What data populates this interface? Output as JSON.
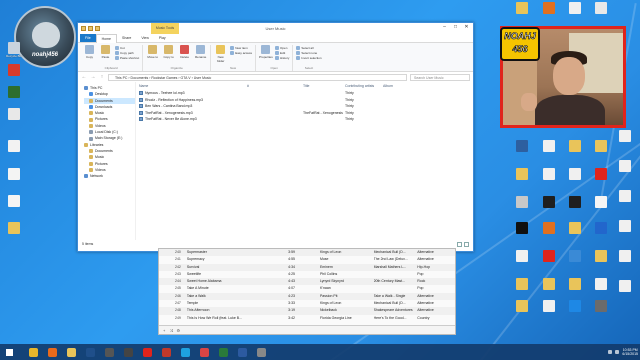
{
  "logo": {
    "text": "noahj456"
  },
  "desktop_left": [
    {
      "label": "Recycle Bin",
      "color": "#c9d3de"
    },
    {
      "label": "",
      "color": "#d83a2a"
    },
    {
      "label": "",
      "color": "#2d6e2e"
    },
    {
      "label": "",
      "color": "#e8e8e8"
    },
    {
      "label": "",
      "color": "#f2f2f2"
    },
    {
      "label": "",
      "color": "#f4f4f4"
    },
    {
      "label": "",
      "color": "#f4f4f4"
    },
    {
      "label": "",
      "color": "#e9c45a"
    }
  ],
  "desktop_right": [
    {
      "label": "",
      "color": "#e9c45a"
    },
    {
      "label": "",
      "color": "#e07020"
    },
    {
      "label": "",
      "color": "#f0f0f0"
    },
    {
      "label": "",
      "color": "#e8e8e8"
    },
    {
      "label": "",
      "color": "#2d5fa0"
    },
    {
      "label": "",
      "color": "#f0f0f0"
    },
    {
      "label": "",
      "color": "#e9c45a"
    },
    {
      "label": "",
      "color": "#e9c45a"
    },
    {
      "label": "",
      "color": "#e9c45a"
    },
    {
      "label": "",
      "color": "#f0f0f0"
    },
    {
      "label": "",
      "color": "#f0f0f0"
    },
    {
      "label": "",
      "color": "#e0241c"
    },
    {
      "label": "",
      "color": "#c8c8c8"
    },
    {
      "label": "",
      "color": "#1f1f1f"
    },
    {
      "label": "",
      "color": "#1f1f1f"
    },
    {
      "label": "",
      "color": "#f5f5f5"
    },
    {
      "label": "",
      "color": "#101010"
    },
    {
      "label": "",
      "color": "#e07020"
    },
    {
      "label": "",
      "color": "#e9c45a"
    },
    {
      "label": "",
      "color": "#2266cc"
    },
    {
      "label": "",
      "color": "#f0f0f0"
    },
    {
      "label": "",
      "color": "#e0241c"
    },
    {
      "label": "",
      "color": "#3a8ad6"
    },
    {
      "label": "",
      "color": "#e9c45a"
    },
    {
      "label": "",
      "color": "#e9c45a"
    },
    {
      "label": "",
      "color": "#e9c45a"
    },
    {
      "label": "",
      "color": "#e9c45a"
    },
    {
      "label": "",
      "color": "#f0f0f0"
    },
    {
      "label": "",
      "color": "#e9c45a"
    },
    {
      "label": "",
      "color": "#f0f0f0"
    },
    {
      "label": "",
      "color": "#1e88e5"
    },
    {
      "label": "",
      "color": "#6b6b6b"
    }
  ],
  "explorer": {
    "title": "User Music",
    "context_tab": "Music Tools",
    "controls": {
      "min": "–",
      "max": "□",
      "close": "✕"
    },
    "tabs": [
      "File",
      "Home",
      "Share",
      "View",
      "Play"
    ],
    "ribbon": {
      "clipboard": {
        "name": "Clipboard",
        "copy": "Copy",
        "paste": "Paste",
        "cut": "Cut",
        "copy_path": "Copy path",
        "paste_shortcut": "Paste shortcut"
      },
      "organize": {
        "name": "Organize",
        "move_to": "Move to",
        "copy_to": "Copy to",
        "delete": "Delete",
        "rename": "Rename"
      },
      "new": {
        "name": "New",
        "new_folder": "New folder",
        "new_item": "New item",
        "easy_access": "Easy access"
      },
      "open": {
        "name": "Open",
        "properties": "Properties",
        "open": "Open",
        "edit": "Edit",
        "history": "History"
      },
      "select": {
        "name": "Select",
        "select_all": "Select all",
        "select_none": "Select none",
        "invert": "Invert selection"
      }
    },
    "address": "This PC  ›  Documents  ›  Rockstar Games  ›  GTA V  ›  User Music",
    "search_placeholder": "Search User Music",
    "nav": [
      {
        "label": "This PC",
        "color": "#5a8fd0",
        "sel": false
      },
      {
        "label": "Desktop",
        "color": "#4a90e2",
        "sel": false
      },
      {
        "label": "Documents",
        "color": "#d9b55a",
        "sel": true
      },
      {
        "label": "Downloads",
        "color": "#4a90e2",
        "sel": false
      },
      {
        "label": "Music",
        "color": "#d9b55a",
        "sel": false
      },
      {
        "label": "Pictures",
        "color": "#d9b55a",
        "sel": false
      },
      {
        "label": "Videos",
        "color": "#d9b55a",
        "sel": false
      },
      {
        "label": "Local Disk (C:)",
        "color": "#8a9bb0",
        "sel": false
      },
      {
        "label": "Main Storage (E:)",
        "color": "#8a9bb0",
        "sel": false
      },
      {
        "label": "Libraries",
        "color": "#d9b55a",
        "sel": false
      },
      {
        "label": "Documents",
        "color": "#d9b55a",
        "sel": false
      },
      {
        "label": "Music",
        "color": "#d9b55a",
        "sel": false
      },
      {
        "label": "Pictures",
        "color": "#d9b55a",
        "sel": false
      },
      {
        "label": "Videos",
        "color": "#d9b55a",
        "sel": false
      },
      {
        "label": "",
        "color": "",
        "sel": false
      },
      {
        "label": "Network",
        "color": "#5a8fd0",
        "sel": false
      }
    ],
    "columns": [
      "Name",
      "#",
      "Title",
      "Contributing artists",
      "Album"
    ],
    "files": [
      {
        "name": "Nymous - Teehee lol.mp3",
        "num": "",
        "title": "",
        "artist": "Thirty",
        "album": ""
      },
      {
        "name": "Rhodz - Reflection of Happiness.mp3",
        "num": "",
        "title": "",
        "artist": "Thirty",
        "album": ""
      },
      {
        "name": "Ben Wars - Cantina Band.mp3",
        "num": "",
        "title": "",
        "artist": "Thirty",
        "album": ""
      },
      {
        "name": "TheFatRat - Xenogenesis.mp3",
        "num": "",
        "title": "TheFatRat - Xenogenesis",
        "artist": "Thirty",
        "album": ""
      },
      {
        "name": "TheFatRat - Never Be Alone.mp3",
        "num": "",
        "title": "",
        "artist": "Thirty",
        "album": ""
      }
    ],
    "status": "5 items"
  },
  "player": {
    "rows": [
      {
        "n": "240",
        "title": "Supermaster",
        "time": "3:59",
        "artist": "Kings of Leon",
        "album": "Mechanical Bull (D...",
        "genre": "Alternative"
      },
      {
        "n": "241",
        "title": "Supremacy",
        "time": "4:55",
        "artist": "Muse",
        "album": "The 2nd Law (Delux...",
        "genre": "Alternative"
      },
      {
        "n": "242",
        "title": "Survival",
        "time": "4:34",
        "artist": "Eminem",
        "album": "Marshall Mathers L...",
        "genre": "Hip-Hop"
      },
      {
        "n": "243",
        "title": "Sweetlife",
        "time": "4:25",
        "artist": "Phil Collins",
        "album": "",
        "genre": "Pop"
      },
      {
        "n": "244",
        "title": "Sweet Home Alabama",
        "time": "4:43",
        "artist": "Lynyrd Skynyrd",
        "album": "20th Century Mast...",
        "genre": "Rock"
      },
      {
        "n": "245",
        "title": "Take A Minute",
        "time": "4:07",
        "artist": "K'naan",
        "album": "",
        "genre": "Pop"
      },
      {
        "n": "246",
        "title": "Take a Walk",
        "time": "4:23",
        "artist": "Passion Pit",
        "album": "Take a Walk - Single",
        "genre": "Alternative"
      },
      {
        "n": "247",
        "title": "Temple",
        "time": "3:33",
        "artist": "Kings of Leon",
        "album": "Mechanical Bull (D...",
        "genre": "Alternative"
      },
      {
        "n": "248",
        "title": "This Afternoon",
        "time": "3:19",
        "artist": "Nickelback",
        "album": "Shakespeare Adventures",
        "genre": "Alternative"
      },
      {
        "n": "249",
        "title": "This Is How We Roll (feat. Luke B...",
        "time": "3:42",
        "artist": "Florida Georgia Line",
        "album": "Here's To the Good...",
        "genre": "Country"
      }
    ]
  },
  "overlay": {
    "line1": "NOAHJ",
    "line2": "456"
  },
  "taskbar": {
    "items": [
      {
        "name": "start",
        "color": "#ffffff"
      },
      {
        "name": "chrome",
        "color": "#e8b62c"
      },
      {
        "name": "firefox",
        "color": "#e86a1c"
      },
      {
        "name": "folder",
        "color": "#e9c45a"
      },
      {
        "name": "photoshop",
        "color": "#1f4f8a"
      },
      {
        "name": "app",
        "color": "#555555"
      },
      {
        "name": "app2",
        "color": "#444444"
      },
      {
        "name": "record",
        "color": "#e0241c"
      },
      {
        "name": "media",
        "color": "#c0392b"
      },
      {
        "name": "skype",
        "color": "#1ea1e0"
      },
      {
        "name": "music",
        "color": "#d94545"
      },
      {
        "name": "excel",
        "color": "#2a7a3a"
      },
      {
        "name": "word",
        "color": "#2c5aa0"
      },
      {
        "name": "screen",
        "color": "#888888"
      }
    ],
    "time": "10:53 PM",
    "date": "6/15/2015"
  }
}
